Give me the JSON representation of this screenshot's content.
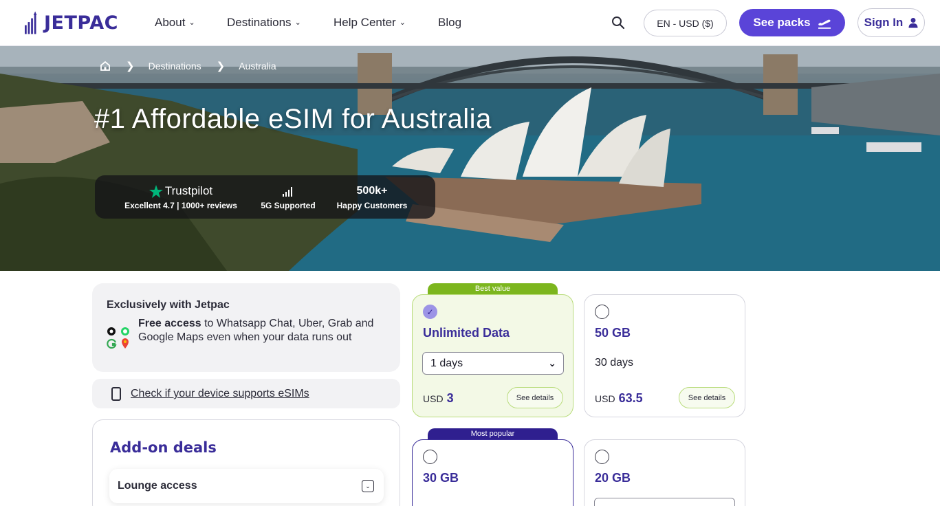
{
  "header": {
    "logo_text": "JETPAC",
    "nav": [
      {
        "label": "About",
        "has_dropdown": true
      },
      {
        "label": "Destinations",
        "has_dropdown": true
      },
      {
        "label": "Help Center",
        "has_dropdown": true
      },
      {
        "label": "Blog",
        "has_dropdown": false
      }
    ],
    "search_icon": "search-icon",
    "language_currency": "EN - USD ($)",
    "see_packs_label": "See packs",
    "sign_in_label": "Sign In"
  },
  "hero": {
    "breadcrumb": [
      "Destinations",
      "Australia"
    ],
    "home_icon": "home-icon",
    "title": "#1 Affordable eSIM for Australia",
    "stats": [
      {
        "top": "Trustpilot",
        "bottom": "Excellent 4.7 | 1000+ reviews",
        "icon": "star-icon"
      },
      {
        "top": "",
        "bottom": "5G Supported",
        "icon": "signal-icon"
      },
      {
        "top": "500k+",
        "bottom": "Happy Customers",
        "icon": ""
      }
    ]
  },
  "exclusive": {
    "title": "Exclusively with Jetpac",
    "text_bold": "Free access",
    "text_rest": " to Whatsapp Chat, Uber, Grab and Google Maps even when your data runs out"
  },
  "device_check": {
    "link_text": "Check if your device supports eSIMs"
  },
  "addons": {
    "title": "Add-on deals",
    "items": [
      {
        "label": "Lounge access"
      }
    ]
  },
  "plans": [
    {
      "ribbon": "Best value",
      "name": "Unlimited Data",
      "days": "1 days",
      "days_is_select": true,
      "currency": "USD",
      "price": "3",
      "details_label": "See details",
      "selected": true
    },
    {
      "ribbon": "",
      "name": "50 GB",
      "days": "30 days",
      "days_is_select": false,
      "currency": "USD",
      "price": "63.5",
      "details_label": "See details",
      "selected": false
    },
    {
      "ribbon": "Most popular",
      "name": "30 GB",
      "days": "",
      "selected": false
    },
    {
      "ribbon": "",
      "name": "20 GB",
      "days": "",
      "selected": false
    }
  ],
  "colors": {
    "brand": "#3a2d99",
    "accent_button": "#5a44d8",
    "best_value_green": "#7cb61e",
    "most_popular_purple": "#2f1f8f",
    "selected_card_bg": "#f3f9e6",
    "trustpilot_star": "#00b67a"
  }
}
